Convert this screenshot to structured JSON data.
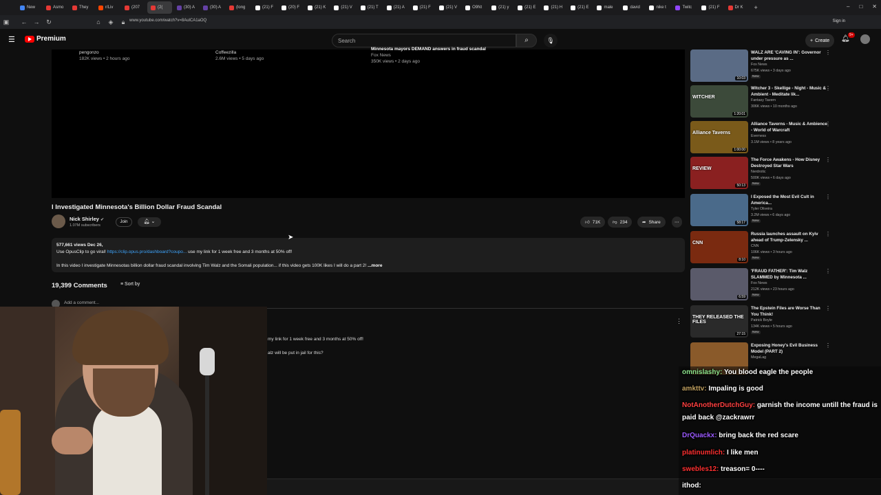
{
  "browser": {
    "tabs": [
      {
        "label": "New",
        "color": "#4285f4"
      },
      {
        "label": "Asmo",
        "color": "#e53935"
      },
      {
        "label": "They",
        "color": "#e53935"
      },
      {
        "label": "r/Liv",
        "color": "#ff4500"
      },
      {
        "label": "(207",
        "color": "#e53935"
      },
      {
        "label": "(2(",
        "color": "#e53935",
        "active": true
      },
      {
        "label": "(30) A",
        "color": "#6441a5"
      },
      {
        "label": "(30) A",
        "color": "#6441a5"
      },
      {
        "label": "(long",
        "color": "#e53935"
      },
      {
        "label": "(21) F",
        "color": "#ffffff"
      },
      {
        "label": "(20) F",
        "color": "#ffffff"
      },
      {
        "label": "(21) K",
        "color": "#ffffff"
      },
      {
        "label": "(21) V",
        "color": "#ffffff"
      },
      {
        "label": "(21) T",
        "color": "#ffffff"
      },
      {
        "label": "(21) A",
        "color": "#ffffff"
      },
      {
        "label": "(21) F",
        "color": "#ffffff"
      },
      {
        "label": "(21) V",
        "color": "#ffffff"
      },
      {
        "label": "O9Nt",
        "color": "#ffffff"
      },
      {
        "label": "(21) y",
        "color": "#ffffff"
      },
      {
        "label": "(21) E",
        "color": "#ffffff"
      },
      {
        "label": "(21) H",
        "color": "#ffffff"
      },
      {
        "label": "(21) E",
        "color": "#ffffff"
      },
      {
        "label": "male",
        "color": "#ffffff"
      },
      {
        "label": "david",
        "color": "#ffffff"
      },
      {
        "label": "nike t",
        "color": "#ffffff"
      },
      {
        "label": "Twitc",
        "color": "#9146ff"
      },
      {
        "label": "(21) F",
        "color": "#ffffff"
      },
      {
        "label": "Dr K",
        "color": "#e53935"
      }
    ],
    "new_tab": "+",
    "url": "www.youtube.com/watch?v=8AulCA1aOQ",
    "sign_in": "Sign in"
  },
  "header": {
    "logo_text": "Premium",
    "search_placeholder": "Search",
    "create_label": "Create",
    "notif_badge": "9+"
  },
  "endcards": [
    {
      "channel": "pengonzo",
      "meta": "182K views • 2 hours ago"
    },
    {
      "channel": "Coffeezilla",
      "meta": "2.6M views • 5 days ago"
    },
    {
      "title": "Minnesota mayors DEMAND answers in fraud scandal",
      "channel": "Fox News",
      "meta": "350K views • 2 days ago"
    }
  ],
  "video": {
    "title": "I Investigated Minnesota's Billion Dollar Fraud Scandal",
    "channel": "Nick Shirley",
    "subscribers": "1.07M subscribers",
    "join": "Join",
    "likes": "71K",
    "dislikes": "234",
    "share": "Share",
    "views_date": "577,661 views  Dec 26,",
    "desc_line1_pre": "Use OpusClip to go viral!",
    "desc_link": "https://clip.opus.pro/dashboard?coupo...",
    "desc_line1_post": "use my link for 1 week free and 3 months at 50% off!",
    "desc_line2": "In this video I investigate Minnesotas billion dollar fraud scandal involving Tim Walz and the Somali population... if this video gets 100K likes I will do a part 2!",
    "more": "...more"
  },
  "comments": {
    "count": "19,399 Comments",
    "sort": "Sort by",
    "add_placeholder": "Add a comment...",
    "partial1": "my link for 1 week free and 3 months at 50% off!",
    "partial2": "alz will be put in jail for this?"
  },
  "sidebar": [
    {
      "title": "WALZ ARE 'CAVING IN': Governor under pressure as ...",
      "channel": "Fox News",
      "meta": "675K views • 3 days ago",
      "new": "New",
      "dur": "10:03",
      "thumb": "#5a6b85",
      "thumbtext": ""
    },
    {
      "title": "Witcher 3 - Skellige - Night - Music & Ambient - Meditate lik...",
      "channel": "Fantasy Tavern",
      "meta": "306K views • 10 months ago",
      "new": "",
      "dur": "1:20:01",
      "thumb": "#3c4a3a",
      "thumbtext": "WITCHER"
    },
    {
      "title": "Alliance Taverns - Music & Ambience - World of Warcraft",
      "channel": "Everness",
      "meta": "3.1M views • 8 years ago",
      "new": "",
      "dur": "1:00:00",
      "thumb": "#7a5a1a",
      "thumbtext": "Alliance Taverns"
    },
    {
      "title": "The Force Awakens - How Disney Destroyed Star Wars",
      "channel": "Nerdrotic",
      "meta": "500K views • 6 days ago",
      "new": "New",
      "dur": "50:13",
      "thumb": "#8a2020",
      "thumbtext": "REVIEW"
    },
    {
      "title": "I Exposed the Most Evil Cult in America...",
      "channel": "Tyler Oliveira",
      "meta": "3.2M views • 6 days ago",
      "new": "New",
      "dur": "58:17",
      "thumb": "#4a6a8a",
      "thumbtext": ""
    },
    {
      "title": "Russia launches assault on Kyiv ahead of Trump-Zelensky ...",
      "channel": "CNN",
      "meta": "106K views • 3 hours ago",
      "new": "New",
      "dur": "8:10",
      "thumb": "#7a2a10",
      "thumbtext": "CNN"
    },
    {
      "title": "'FRAUD FATHER': Tim Walz SLAMMED by Minnesota ...",
      "channel": "Fox News",
      "meta": "212K views • 23 hours ago",
      "new": "New",
      "dur": "6:59",
      "thumb": "#5a5a6a",
      "thumbtext": ""
    },
    {
      "title": "The Epstein Files are Worse Than You Think!",
      "channel": "Patrick Boyle",
      "meta": "134K views • 5 hours ago",
      "new": "New",
      "dur": "27:15",
      "thumb": "#2a2a2a",
      "thumbtext": "THEY RELEASED THE FILES"
    },
    {
      "title": "Exposing Honey's Evil Business Model (PART 2)",
      "channel": "MegaLag",
      "meta": "",
      "new": "",
      "dur": "",
      "thumb": "#8a5a2a",
      "thumbtext": ""
    }
  ],
  "chat": [
    {
      "user": "omnislashy:",
      "text": "You blood eagle the people",
      "color": "#8be28b"
    },
    {
      "user": "amkttv:",
      "text": "Impaling is good",
      "color": "#c0a060"
    },
    {
      "user": "NotAnotherDutchGuy:",
      "text": "garnish the income untill the fraud is paid back @zackrawrr",
      "color": "#ff4040"
    },
    {
      "user": "DrQuackx:",
      "text": "bring back the red scare",
      "color": "#9b59ff"
    },
    {
      "user": "platinumlich:",
      "text": "I like men",
      "color": "#ff3030"
    },
    {
      "user": "swebles12:",
      "text": "treason= 0----",
      "color": "#ff3030"
    },
    {
      "user": "ithod:",
      "text": "",
      "color": "#ffffff"
    }
  ]
}
